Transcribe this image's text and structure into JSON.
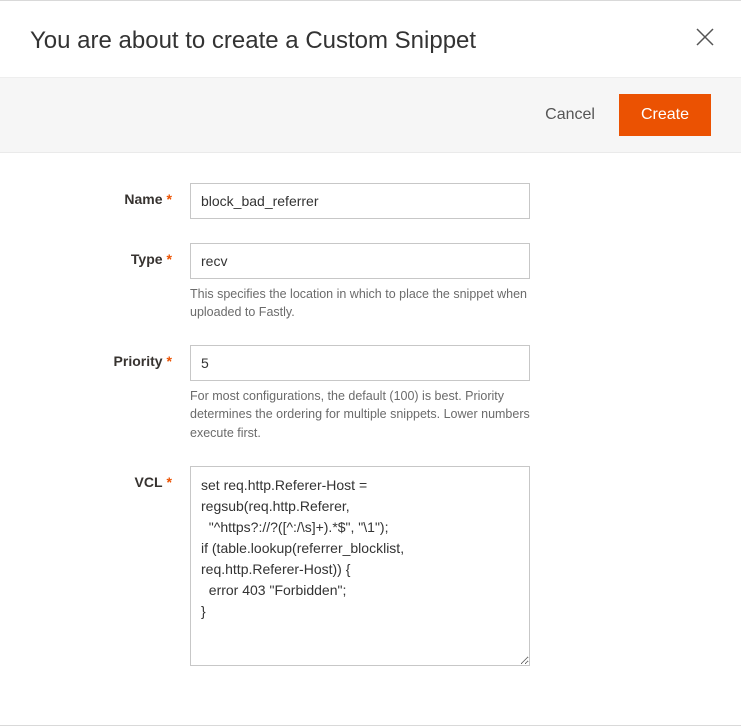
{
  "dialog": {
    "title": "You are about to create a Custom Snippet",
    "cancel_label": "Cancel",
    "create_label": "Create"
  },
  "form": {
    "name": {
      "label": "Name",
      "value": "block_bad_referrer"
    },
    "type": {
      "label": "Type",
      "value": "recv",
      "hint": "This specifies the location in which to place the snippet when uploaded to Fastly."
    },
    "priority": {
      "label": "Priority",
      "value": "5",
      "hint": "For most configurations, the default (100) is best. Priority determines the ordering for multiple snippets. Lower numbers execute first."
    },
    "vcl": {
      "label": "VCL",
      "value": "set req.http.Referer-Host =\nregsub(req.http.Referer,\n  \"^https?://?([^:/\\s]+).*$\", \"\\1\");\nif (table.lookup(referrer_blocklist,\nreq.http.Referer-Host)) {\n  error 403 \"Forbidden\";\n}"
    }
  }
}
